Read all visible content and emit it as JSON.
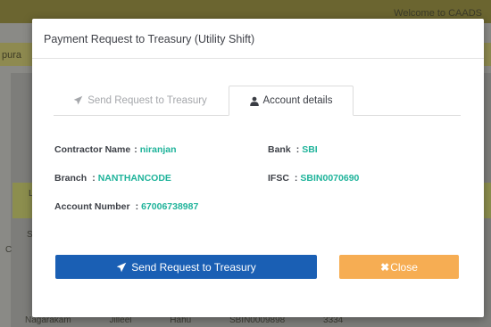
{
  "background": {
    "welcome_text": "Welcome to CAADS",
    "band_text": "pura",
    "letters": [
      "L",
      "S",
      "C"
    ],
    "footer_cells": [
      "Nagarakam",
      "",
      "Jilleel",
      "",
      "Hahu",
      "SBIN0009898",
      "3334"
    ]
  },
  "modal": {
    "title": "Payment Request to Treasury (Utility Shift)",
    "tabs": {
      "send_label": "Send Request to Treasury",
      "account_label": "Account details"
    },
    "fields": {
      "contractor_name_label": "Contractor Name",
      "contractor_name_value": "niranjan",
      "bank_label": "Bank",
      "bank_value": "SBI",
      "branch_label": "Branch",
      "branch_value": "NANTHANCODE",
      "ifsc_label": "IFSC",
      "ifsc_value": "SBIN0070690",
      "account_number_label": "Account Number",
      "account_number_value": "67006738987"
    },
    "buttons": {
      "send_label": "Send Request to Treasury",
      "close_label": "Close"
    }
  },
  "colors": {
    "send_button": "#1a5fb4",
    "close_button": "#f6ad53",
    "field_value": "#1eb39a"
  },
  "icons": {
    "send": "paper-plane-icon",
    "account": "user-icon",
    "close": "close-icon"
  }
}
